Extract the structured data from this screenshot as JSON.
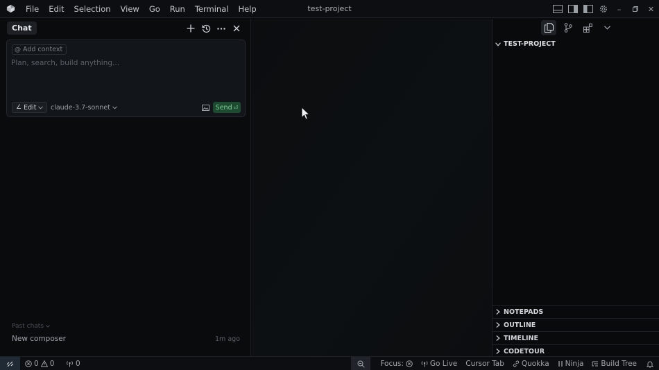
{
  "titlebar": {
    "window_title": "test-project",
    "menu": [
      "File",
      "Edit",
      "Selection",
      "View",
      "Go",
      "Run",
      "Terminal",
      "Help"
    ]
  },
  "chat": {
    "tab_label": "Chat",
    "add_context_label": "Add context",
    "prompt_placeholder": "Plan, search, build anything...",
    "mode_label": "Edit",
    "model_label": "claude-3.7-sonnet",
    "send_label": "Send",
    "past_chats_label": "Past chats",
    "history": [
      {
        "title": "New composer",
        "time": "1m ago"
      }
    ]
  },
  "explorer": {
    "project_name": "TEST-PROJECT",
    "sections": [
      "NOTEPADS",
      "OUTLINE",
      "TIMELINE",
      "CODETOUR"
    ]
  },
  "statusbar": {
    "errors": "0",
    "warnings": "0",
    "ports": "0",
    "focus_label": "Focus:",
    "go_live_label": "Go Live",
    "cursor_tab_label": "Cursor Tab",
    "quokka_label": "Quokka",
    "ninja_label": "Ninja",
    "build_tree_label": "Build Tree"
  },
  "colors": {
    "accent_send": "#1f4a32",
    "background": "#0a0c0e"
  }
}
